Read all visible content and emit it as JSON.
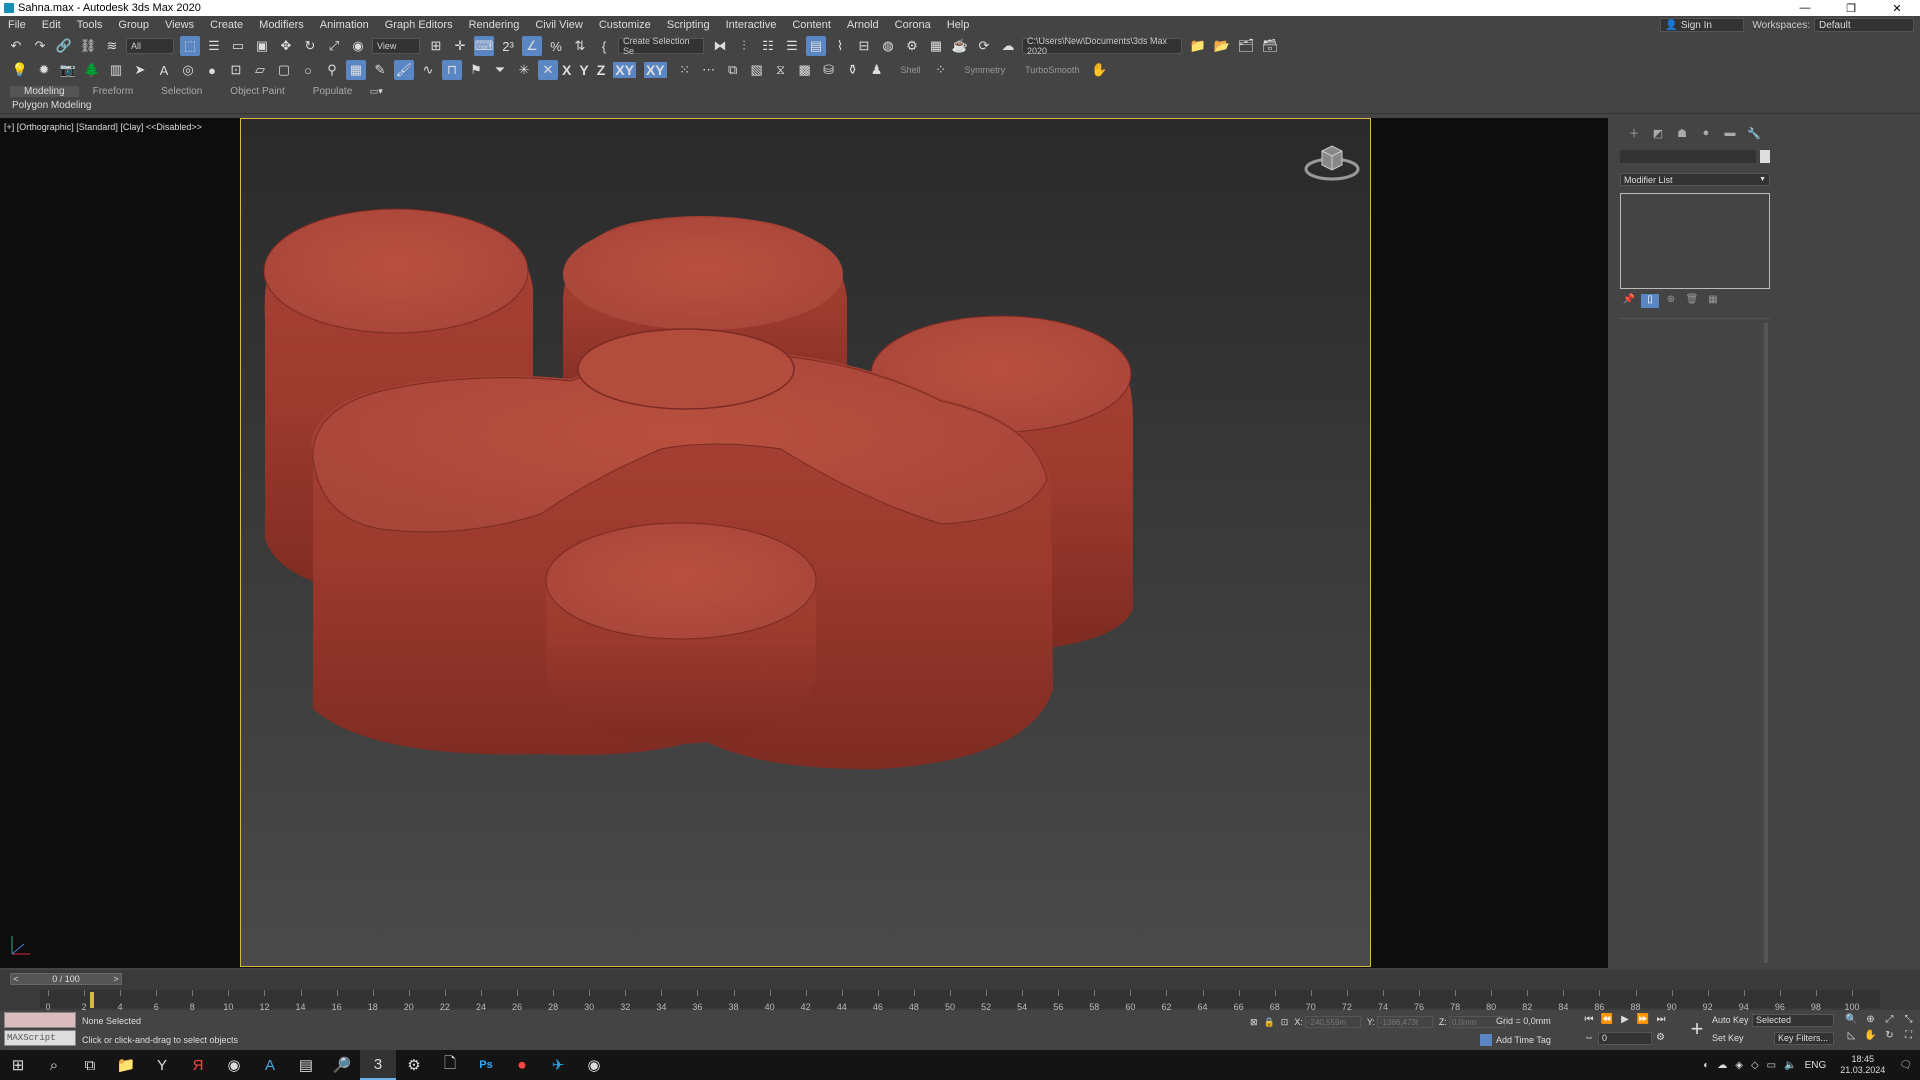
{
  "window": {
    "title": "Sahna.max - Autodesk 3ds Max 2020",
    "controls": [
      "—",
      "❐",
      "✕"
    ]
  },
  "menu": [
    "File",
    "Edit",
    "Tools",
    "Group",
    "Views",
    "Create",
    "Modifiers",
    "Animation",
    "Graph Editors",
    "Rendering",
    "Civil View",
    "Customize",
    "Scripting",
    "Interactive",
    "Content",
    "Arnold",
    "Corona",
    "Help"
  ],
  "account": {
    "signin_label": "Sign In",
    "workspaces_label": "Workspaces:",
    "workspace_value": "Default"
  },
  "toolbar1": {
    "filter_value": "All",
    "ref_coord_value": "View",
    "selection_set_placeholder": "Create Selection Se",
    "project_path": "C:\\Users\\New\\Documents\\3ds Max 2020"
  },
  "toolbar2": {
    "axes": [
      "X",
      "Y",
      "Z",
      "XY",
      "XY"
    ],
    "shell_label": "Shell",
    "symmetry_label": "Symmetry",
    "turbosmooth_label": "TurboSmooth"
  },
  "ribbon": {
    "tabs": [
      "Modeling",
      "Freeform",
      "Selection",
      "Object Paint",
      "Populate"
    ],
    "active_tab": "Modeling",
    "sub_label": "Polygon Modeling"
  },
  "viewport": {
    "label": "[+] [Orthographic] [Standard] [Clay] <<Disabled>>",
    "frame_color": "#d4b83f",
    "clay_color": "#b14a3d"
  },
  "command_panel": {
    "modifier_list_label": "Modifier List"
  },
  "timeline": {
    "slider_label": "0 / 100",
    "ticks": [
      0,
      2,
      4,
      6,
      8,
      10,
      12,
      14,
      16,
      18,
      20,
      22,
      24,
      26,
      28,
      30,
      32,
      34,
      36,
      38,
      40,
      42,
      44,
      46,
      48,
      50,
      52,
      54,
      56,
      58,
      60,
      62,
      64,
      66,
      68,
      70,
      72,
      74,
      76,
      78,
      80,
      82,
      84,
      86,
      88,
      90,
      92,
      94,
      96,
      98,
      100
    ]
  },
  "status": {
    "selection": "None Selected",
    "prompt": "Click or click-and-drag to select objects",
    "maxscript_placeholder": "MAXScript Mi:",
    "x_label": "X:",
    "x_value": "-240,559m",
    "y_label": "Y:",
    "y_value": "-1366,473t",
    "z_label": "Z:",
    "z_value": "0,0mm",
    "grid": "Grid = 0,0mm",
    "add_time_tag": "Add Time Tag",
    "frame_value": "0",
    "auto_key": "Auto Key",
    "set_key": "Set Key",
    "key_mode": "Selected",
    "key_filters": "Key Filters..."
  },
  "taskbar": {
    "language": "ENG",
    "time": "18:45",
    "date": "21.03.2024"
  }
}
